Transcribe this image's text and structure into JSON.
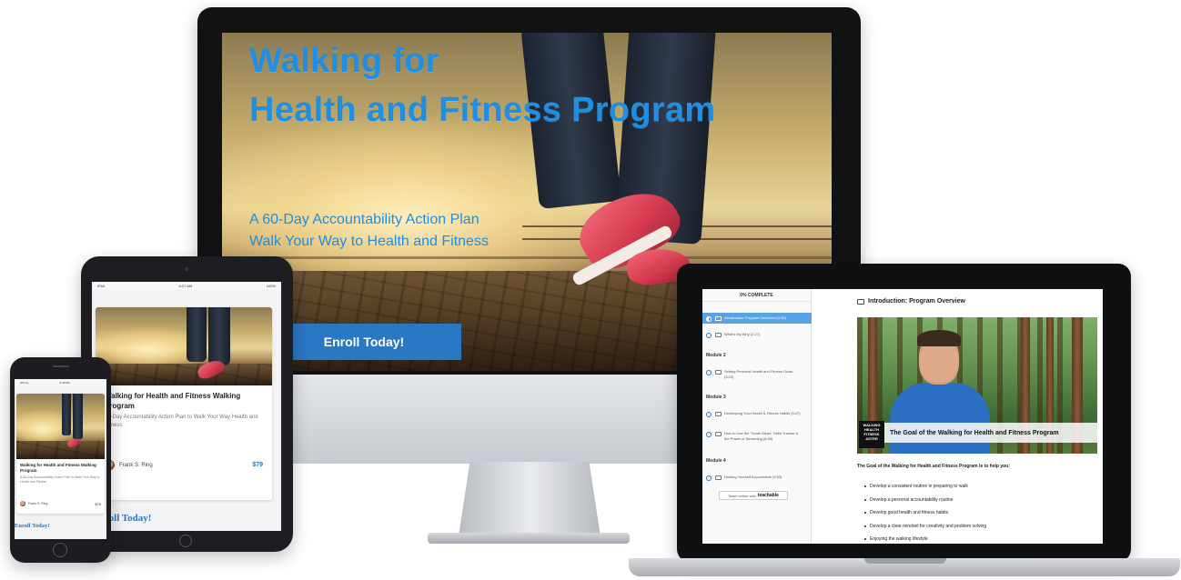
{
  "desktop": {
    "title_line1": "Walking for",
    "title_line2": "Health and Fitness Program",
    "subtitle_line1": "A 60-Day Accountability Action Plan",
    "subtitle_line2": "Walk Your Way to Health and Fitness",
    "enroll_button": "Enroll Today!",
    "accent_color": "#1e8fe3",
    "button_color": "#2a77c4"
  },
  "tablet": {
    "status": {
      "left": "iPad",
      "time": "6:27 AM",
      "battery": "100%"
    },
    "card_title": "Walking for Health and Fitness Walking Program",
    "card_subtitle": "60-Day Accountability Action Plan to Walk Your Way Health and Fitness",
    "author": "Frank S. Ring",
    "price": "$79",
    "enroll_link": "roll Today!"
  },
  "phone": {
    "status": {
      "left": "iPhone",
      "time": "6:48 AM"
    },
    "card_title": "Walking for Health and Fitness Walking Program",
    "card_subtitle": "A 60-Day Accountability Action Plan to Walk Your Way to Health and Fitness",
    "author": "Frank S. Ring",
    "price": "$79",
    "enroll_link": "Enroll Today!"
  },
  "laptop": {
    "progress": "0% COMPLETE",
    "modules": [
      {
        "label": "",
        "lectures": [
          {
            "title": "Introduction: Program Overview (4:30)",
            "active": true
          },
          {
            "title": "What's My Why (2:27)",
            "active": false
          }
        ]
      },
      {
        "label": "Module 2",
        "lectures": [
          {
            "title": "Setting Personal Health and Fitness Goals (5:23)",
            "active": false
          }
        ]
      },
      {
        "label": "Module 3",
        "lectures": [
          {
            "title": "Developing Your Health & Fitness Habits (5:27)",
            "active": false
          },
          {
            "title": "How to Use the \"Small Steps\" Habit Tracker & the Power of Streaming (8:59)",
            "active": false
          }
        ]
      },
      {
        "label": "Module 4",
        "lectures": [
          {
            "title": "Holding Yourself Accountable (9:53)",
            "active": false
          }
        ]
      }
    ],
    "teach_label": "Teach online with",
    "teach_brand": "teachable",
    "lecture_heading": "Introduction: Program Overview",
    "video_caption": "The Goal of the Walking for Health and Fitness Program",
    "video_badge": "WALKING HEALTH FITNESS ASTER",
    "intro_text": "The Goal of the Walking for Health and Fitness Program is to help you:",
    "bullets": [
      "Develop a consistent routine in preparing to walk",
      "Develop a personal accountability routine",
      "Develop good health and fitness habits",
      "Develop a clear mindset for creativity and problem solving",
      "Enjoying the walking lifestyle"
    ]
  }
}
